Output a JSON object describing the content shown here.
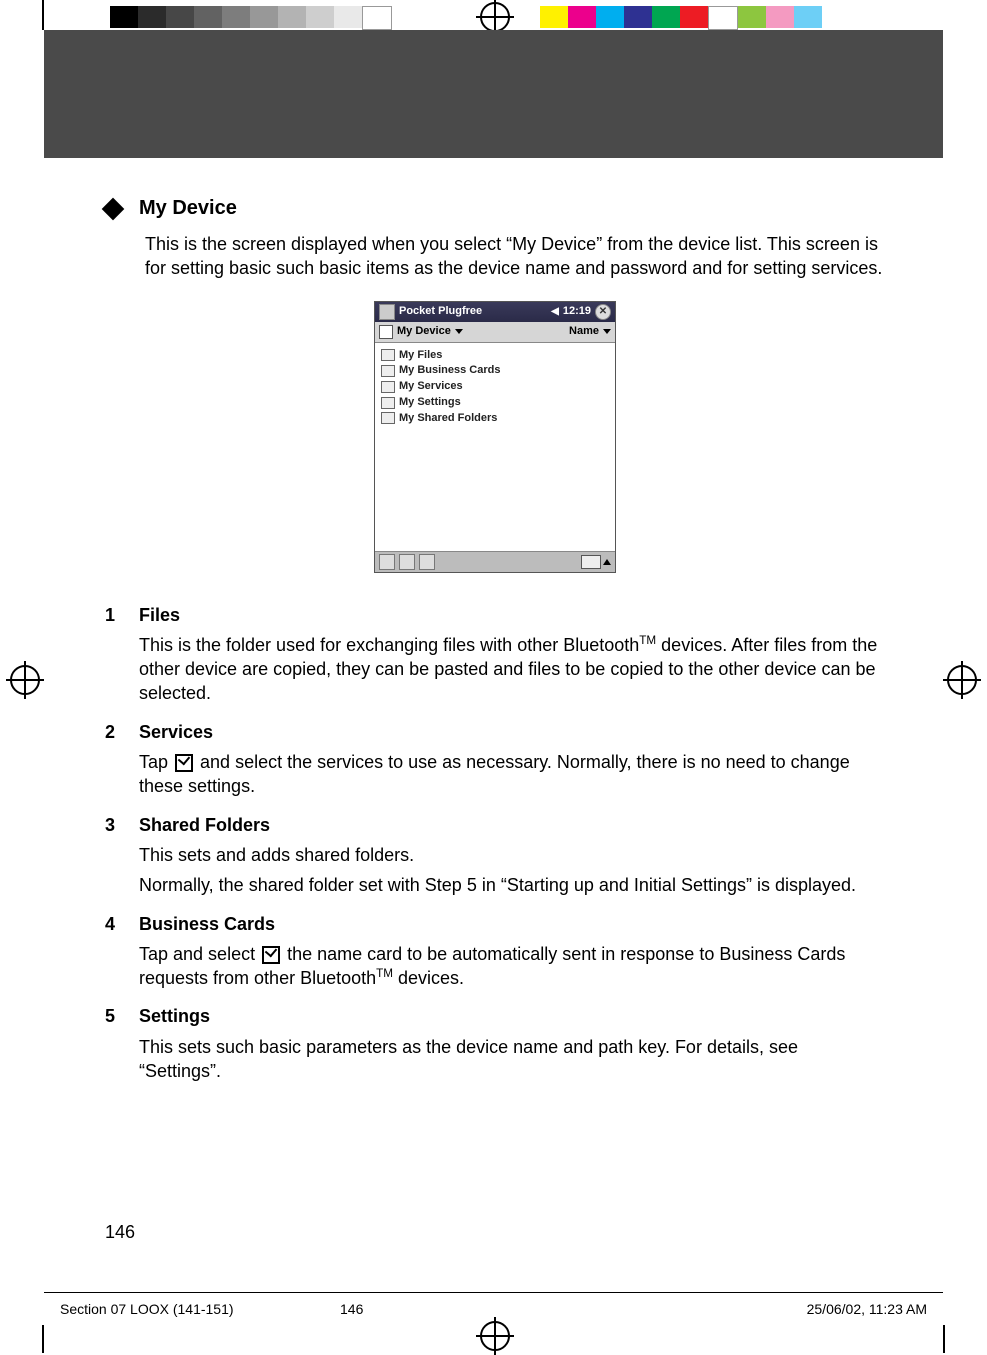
{
  "print": {
    "footer_file": "Section 07 LOOX (141-151)",
    "footer_page": "146",
    "footer_date": "25/06/02, 11:23 AM"
  },
  "page_number": "146",
  "heading": "My Device",
  "intro": "This is the screen displayed when you select “My Device” from the device list.  This screen is for setting basic such basic items as the device name and password and for setting services.",
  "screenshot": {
    "app_title": "Pocket Plugfree",
    "time": "12:19",
    "dropdown_label": "My Device",
    "sort_label": "Name",
    "items": [
      "My Files",
      "My Business Cards",
      "My Services",
      "My Settings",
      "My Shared Folders"
    ]
  },
  "items": [
    {
      "num": "1",
      "title": "Files",
      "paras": [
        "This is the folder used for exchanging files with other Bluetooth™ devices.  After files from the other device are copied, they can be pasted and files to be copied to the other device can be selected."
      ]
    },
    {
      "num": "2",
      "title": "Services",
      "paras": [
        "Tap [CB] and select the services to use as necessary.  Normally, there is no need to change these settings."
      ]
    },
    {
      "num": "3",
      "title": "Shared Folders",
      "paras": [
        "This sets and adds shared folders.",
        "Normally, the shared folder set with Step 5 in “Starting up and Initial Settings” is displayed."
      ]
    },
    {
      "num": "4",
      "title": "Business Cards",
      "paras": [
        "Tap and select [CB] the name card to be automatically sent in response to Business Cards requests from other Bluetooth™ devices."
      ]
    },
    {
      "num": "5",
      "title": "Settings",
      "paras": [
        "This sets such basic parameters as the device name and path key.  For details, see “Settings”."
      ]
    }
  ],
  "colorbar_left": [
    "#000",
    "#2b2b2b",
    "#474747",
    "#626262",
    "#7d7d7d",
    "#989898",
    "#b3b3b3",
    "#cecece",
    "#e9e9e9",
    "#fff"
  ],
  "colorbar_right": [
    "#fff100",
    "#ec008c",
    "#00aeef",
    "#2e3192",
    "#00a651",
    "#ed1c24",
    "#fff",
    "#8dc63f",
    "#f49ac1",
    "#6dcff6"
  ]
}
